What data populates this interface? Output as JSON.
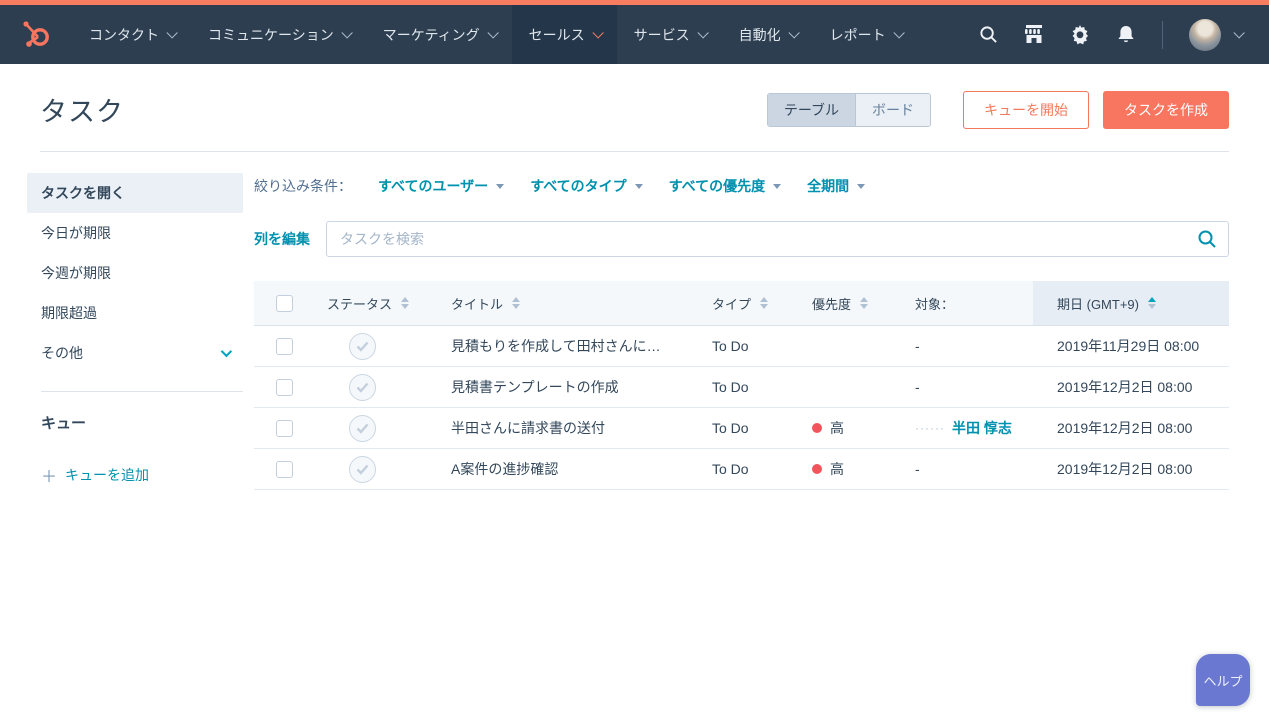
{
  "nav": {
    "items": [
      {
        "label": "コンタクト",
        "active": false
      },
      {
        "label": "コミュニケーション",
        "active": false
      },
      {
        "label": "マーケティング",
        "active": false
      },
      {
        "label": "セールス",
        "active": true
      },
      {
        "label": "サービス",
        "active": false
      },
      {
        "label": "自動化",
        "active": false
      },
      {
        "label": "レポート",
        "active": false
      }
    ],
    "icons": [
      "search-icon",
      "marketplace-icon",
      "settings-icon",
      "notifications-icon",
      "user-avatar"
    ]
  },
  "page": {
    "title": "タスク",
    "view_toggle": {
      "table": "テーブル",
      "board": "ボード"
    },
    "start_queue_label": "キューを開始",
    "create_task_label": "タスクを作成"
  },
  "sidebar": {
    "items": [
      {
        "label": "タスクを開く",
        "active": true
      },
      {
        "label": "今日が期限",
        "active": false
      },
      {
        "label": "今週が期限",
        "active": false
      },
      {
        "label": "期限超過",
        "active": false
      },
      {
        "label": "その他",
        "active": false,
        "expandable": true
      }
    ],
    "queue_header": "キュー",
    "add_queue_label": "キューを追加"
  },
  "filters": {
    "label": "絞り込み条件：",
    "dropdowns": [
      {
        "label": "すべてのユーザー"
      },
      {
        "label": "すべてのタイプ"
      },
      {
        "label": "すべての優先度"
      },
      {
        "label": "全期間"
      }
    ]
  },
  "toolbar": {
    "edit_columns_label": "列を編集",
    "search_placeholder": "タスクを検索"
  },
  "table": {
    "headers": {
      "status": "ステータス",
      "title": "タイトル",
      "type": "タイプ",
      "priority": "優先度",
      "target": "対象：",
      "due": "期日 (GMT+9)"
    },
    "sorted_column": "due",
    "sort_direction": "asc",
    "rows": [
      {
        "title": "見積もりを作成して田村さんに…",
        "type": "To Do",
        "priority": "",
        "target": "-",
        "target_prefix": "",
        "target_link": "",
        "due": "2019年11月29日 08:00"
      },
      {
        "title": "見積書テンプレートの作成",
        "type": "To Do",
        "priority": "",
        "target": "-",
        "target_prefix": "",
        "target_link": "",
        "due": "2019年12月2日 08:00"
      },
      {
        "title": "半田さんに請求書の送付",
        "type": "To Do",
        "priority": "高",
        "target": "",
        "target_prefix": "······",
        "target_link": "半田 惇志",
        "due": "2019年12月2日 08:00"
      },
      {
        "title": "A案件の進捗確認",
        "type": "To Do",
        "priority": "高",
        "target": "-",
        "target_prefix": "",
        "target_link": "",
        "due": "2019年12月2日 08:00"
      }
    ]
  },
  "help": {
    "label": "ヘルプ"
  },
  "colors": {
    "accent_orange": "#f8765f",
    "nav_bg": "#2d3e50",
    "link_blue": "#0091ae",
    "priority_red": "#f2545b",
    "help_purple": "#6a78d1",
    "sort_teal": "#00a4bd"
  }
}
